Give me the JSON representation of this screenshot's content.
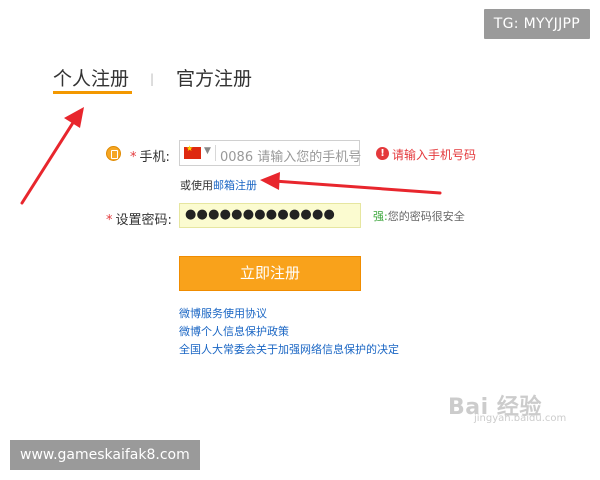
{
  "watermarks": {
    "telegram": "TG: MYYJJPP",
    "site": "www.gameskaifak8.com",
    "baidu_logo": "Bai 经验",
    "baidu_sub": "jingyan.baidu.com"
  },
  "tabs": [
    {
      "label": "个人注册",
      "active": true
    },
    {
      "label": "官方注册",
      "active": false
    }
  ],
  "tab_separator": "|",
  "form": {
    "phone": {
      "required_mark": "*",
      "label": "手机:",
      "flag": "china-flag",
      "placeholder": "0086 请输入您的手机号",
      "error": "请输入手机号码",
      "alt_prefix": "或使用",
      "alt_link": "邮箱注册"
    },
    "password": {
      "required_mark": "*",
      "label": "设置密码:",
      "value": "●●●●●●●●●●●●●",
      "strength_level": "强:",
      "strength_text": "您的密码很安全"
    },
    "submit_label": "立即注册"
  },
  "links": [
    "微博服务使用协议",
    "微博个人信息保护政策",
    "全国人大常委会关于加强网络信息保护的决定"
  ],
  "colors": {
    "accent": "#f39800",
    "submit": "#f9a21b",
    "error": "#e4393c",
    "link": "#1a66c4",
    "annotation_arrow": "#e8262d"
  }
}
